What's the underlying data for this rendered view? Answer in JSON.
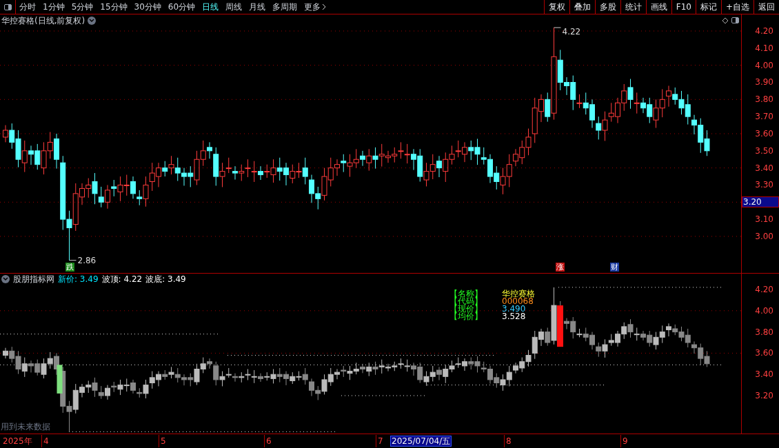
{
  "toolbar": {
    "periods": [
      {
        "label": "分时",
        "selected": false
      },
      {
        "label": "1分钟",
        "selected": false
      },
      {
        "label": "5分钟",
        "selected": false
      },
      {
        "label": "15分钟",
        "selected": false
      },
      {
        "label": "30分钟",
        "selected": false
      },
      {
        "label": "60分钟",
        "selected": false
      },
      {
        "label": "日线",
        "selected": true
      },
      {
        "label": "周线",
        "selected": false
      },
      {
        "label": "月线",
        "selected": false
      },
      {
        "label": "多周期",
        "selected": false
      }
    ],
    "more": "更多",
    "actions": [
      "复权",
      "叠加",
      "多股",
      "统计",
      "画线",
      "F10",
      "标记",
      "+自选",
      "返回"
    ]
  },
  "main_chart": {
    "title": "华控赛格(日线,前复权)",
    "high_label": "4.22",
    "low_label": "2.86",
    "markers": [
      {
        "label": "跌",
        "color": "#1a8a1a"
      },
      {
        "label": "涨",
        "color": "#c01010"
      },
      {
        "label": "财",
        "color": "#1a3aa0"
      }
    ],
    "axis_labels": [
      "4.20",
      "4.10",
      "4.00",
      "3.90",
      "3.80",
      "3.70",
      "3.60",
      "3.50",
      "3.40",
      "3.30",
      "3.10",
      "3.00"
    ],
    "cursor_price": "3.20"
  },
  "indicator_panel": {
    "name": "股朋指标网",
    "readings": [
      {
        "text": "新价: 3.49",
        "color": "#00e5ff"
      },
      {
        "text": "波顶: 4.22",
        "color": "#ffffff"
      },
      {
        "text": "波底: 3.49",
        "color": "#ffffff"
      }
    ],
    "info": [
      {
        "label": "【名称】",
        "value": "华控赛格",
        "color": "#ffff33"
      },
      {
        "label": "【代码】",
        "value": "000068",
        "color": "#ff8c1a"
      },
      {
        "label": "【现价】",
        "value": "3.490",
        "color": "#33ccff"
      },
      {
        "label": "【均价】",
        "value": "3.528",
        "color": "#ffffff"
      }
    ],
    "axis_labels": [
      "4.20",
      "4.00",
      "3.80",
      "3.60",
      "3.40",
      "3.20"
    ],
    "note": "用到未来数据"
  },
  "time_axis": {
    "year": "2025年",
    "months": [
      "4",
      "5",
      "6",
      "7",
      "8",
      "9"
    ],
    "cursor_date": "2025/07/04/五"
  }
}
